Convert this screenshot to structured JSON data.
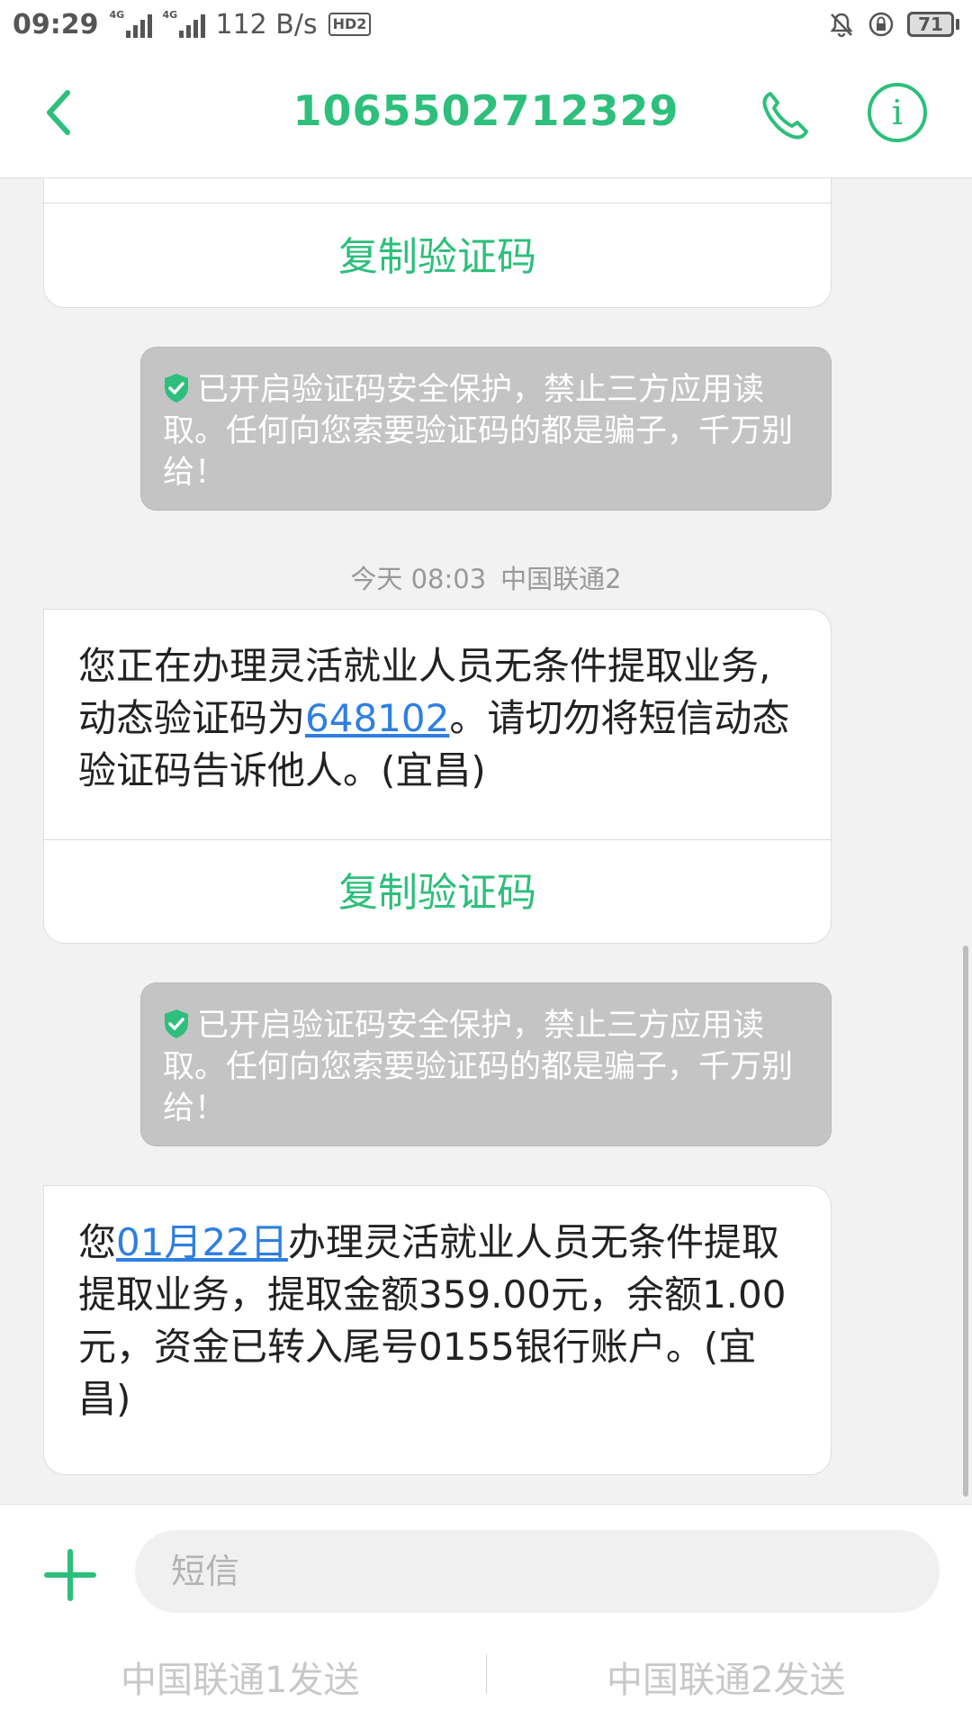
{
  "status_bar": {
    "time": "09:29",
    "net_tag_1": "4G",
    "net_tag_2": "4G",
    "speed": "112 B/s",
    "hd": "HD2",
    "battery": "71"
  },
  "header": {
    "title": "1065502712329"
  },
  "colors": {
    "accent": "#2dbf7b",
    "link": "#2e7fe0",
    "notice_bg": "#c4c4c4"
  },
  "messages": [
    {
      "copy_label": "复制验证码"
    },
    {
      "notice": "已开启验证码安全保护，禁止三方应用读取。任何向您索要验证码的都是骗子，千万别给！"
    },
    {
      "time": "今天 08:03",
      "sim": "中国联通2"
    },
    {
      "text_before": "您正在办理灵活就业人员无条件提取业务,动态验证码为",
      "code": "648102",
      "text_after": "。请切勿将短信动态验证码告诉他人。(宜昌)",
      "copy_label": "复制验证码"
    },
    {
      "notice": "已开启验证码安全保护，禁止三方应用读取。任何向您索要验证码的都是骗子，千万别给！"
    },
    {
      "text_before": "您",
      "date_link": "01月22日",
      "text_after": "办理灵活就业人员无条件提取提取业务，提取金额359.00元，余额1.00元，资金已转入尾号0155银行账户。(宜昌)"
    }
  ],
  "input": {
    "placeholder": "短信",
    "send_sim1": "中国联通1发送",
    "send_sim2": "中国联通2发送"
  }
}
